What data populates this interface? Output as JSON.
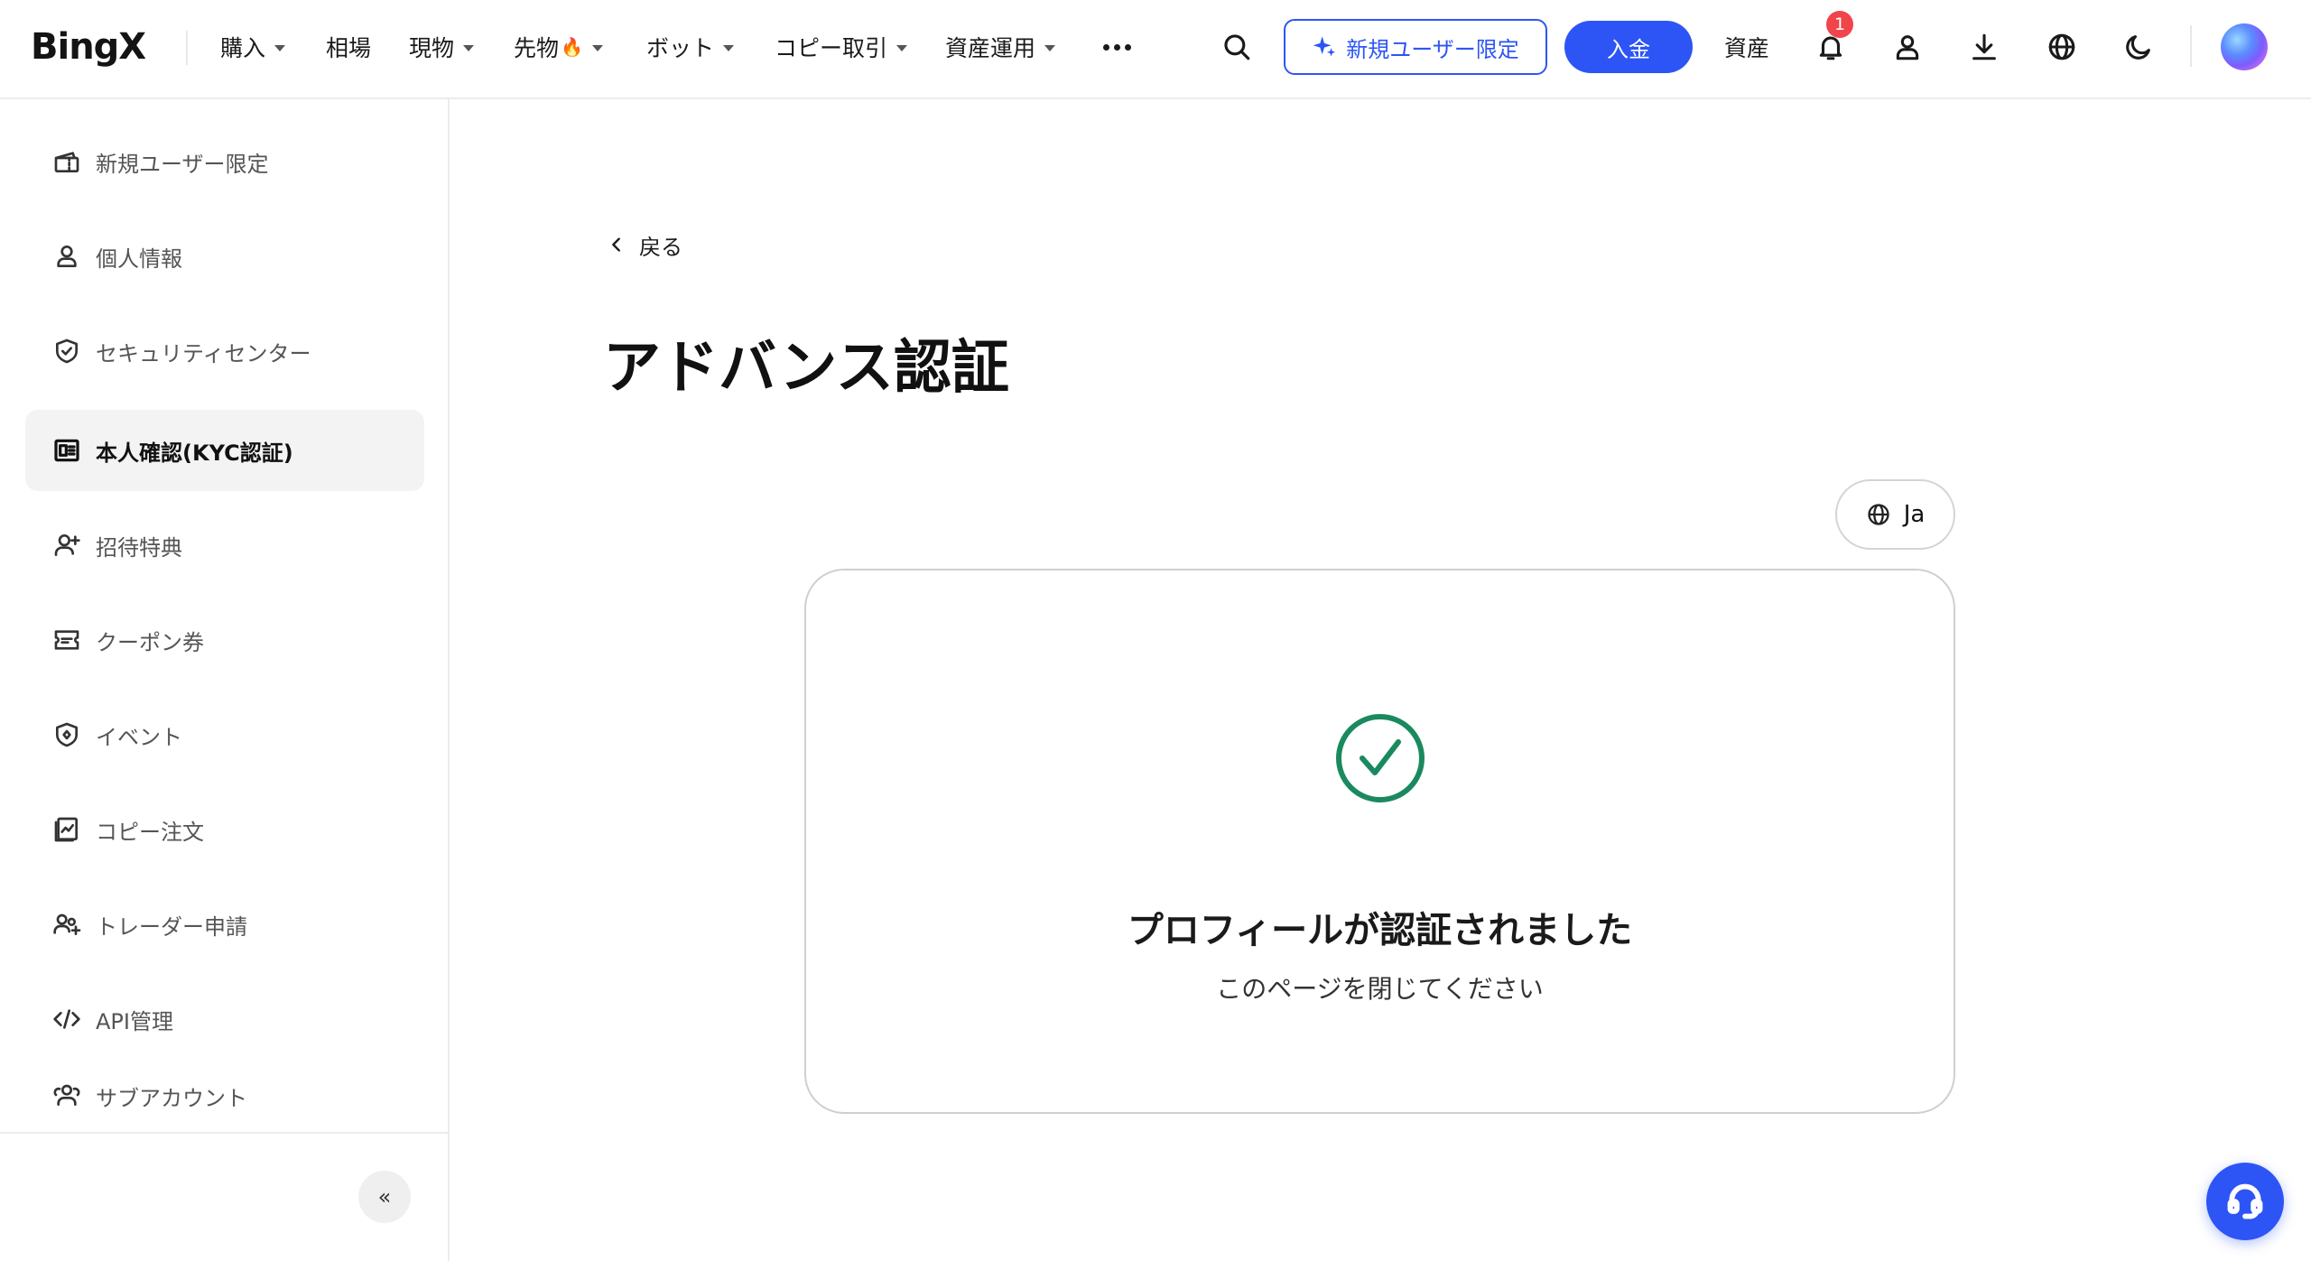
{
  "brand": {
    "logo_text": "BingX",
    "accent_color": "#2d55f5",
    "success_color": "#1a8a5e"
  },
  "nav": {
    "items": [
      {
        "label": "購入",
        "has_dropdown": true
      },
      {
        "label": "相場",
        "has_dropdown": false
      },
      {
        "label": "現物",
        "has_dropdown": true
      },
      {
        "label": "先物",
        "has_dropdown": true,
        "badge_icon": "fire-icon"
      },
      {
        "label": "ボット",
        "has_dropdown": true
      },
      {
        "label": "コピー取引",
        "has_dropdown": true
      },
      {
        "label": "資産運用",
        "has_dropdown": true
      }
    ],
    "more_icon": "more-dots-icon",
    "promo_label": "新規ユーザー限定",
    "deposit_label": "入金",
    "assets_label": "資産",
    "notification_count": "1"
  },
  "sidebar": {
    "items": [
      {
        "label": "新規ユーザー限定",
        "icon": "ticket-icon",
        "active": false
      },
      {
        "label": "個人情報",
        "icon": "user-icon",
        "active": false
      },
      {
        "label": "セキュリティセンター",
        "icon": "shield-icon",
        "active": false
      },
      {
        "label": "本人確認(KYC認証)",
        "icon": "id-card-icon",
        "active": true
      },
      {
        "label": "招待特典",
        "icon": "user-plus-icon",
        "active": false
      },
      {
        "label": "クーポン券",
        "icon": "coupon-icon",
        "active": false
      },
      {
        "label": "イベント",
        "icon": "event-icon",
        "active": false
      },
      {
        "label": "コピー注文",
        "icon": "copy-order-icon",
        "active": false
      },
      {
        "label": "トレーダー申請",
        "icon": "trader-icon",
        "active": false
      },
      {
        "label": "API管理",
        "icon": "code-icon",
        "active": false
      },
      {
        "label": "サブアカウント",
        "icon": "sub-account-icon",
        "active": false
      }
    ],
    "collapse_label": "«"
  },
  "main": {
    "back_label": "戻る",
    "title": "アドバンス認証",
    "language_label": "Ja",
    "status_title": "プロフィールが認証されました",
    "status_subtitle": "このページを閉じてください"
  }
}
